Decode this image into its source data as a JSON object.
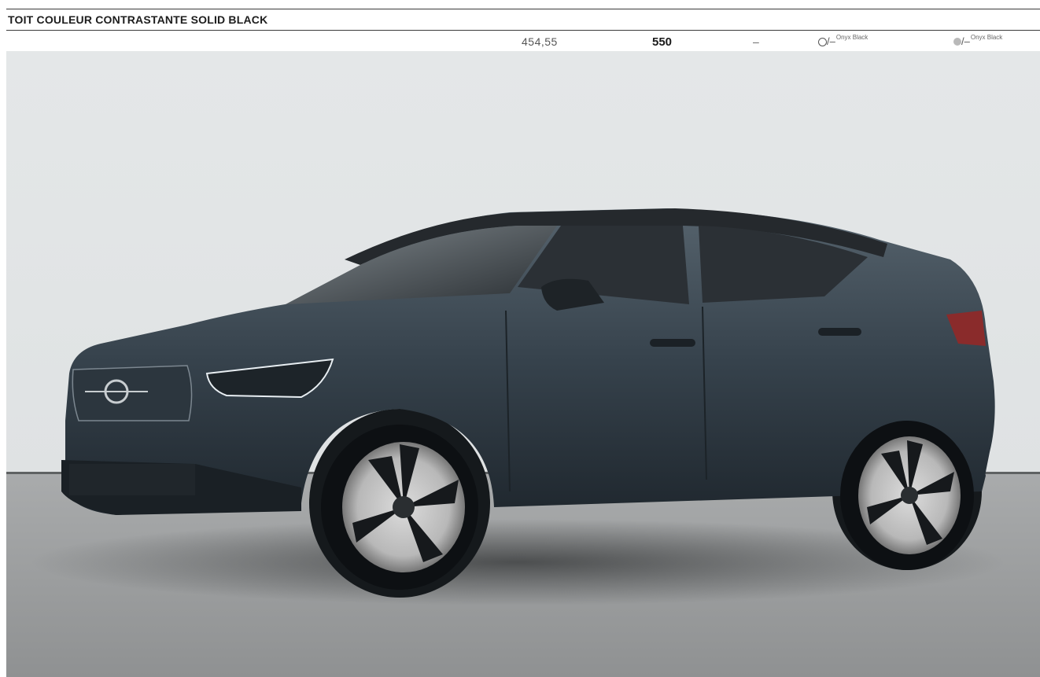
{
  "header": {
    "title": "TOIT COULEUR CONTRASTANTE SOLID BLACK"
  },
  "row": {
    "price_ht": "454,55",
    "price_ttc": "550",
    "dash": "–",
    "col1_prefix": "/–",
    "col1_label": "Onyx Black",
    "col2_prefix": "/–",
    "col2_label": "Onyx Black"
  },
  "colors": {
    "background_wall": "#e6e9ea",
    "floor": "#9ea0a1",
    "car_body": "#3a4650",
    "roof": "#2b2f33"
  }
}
